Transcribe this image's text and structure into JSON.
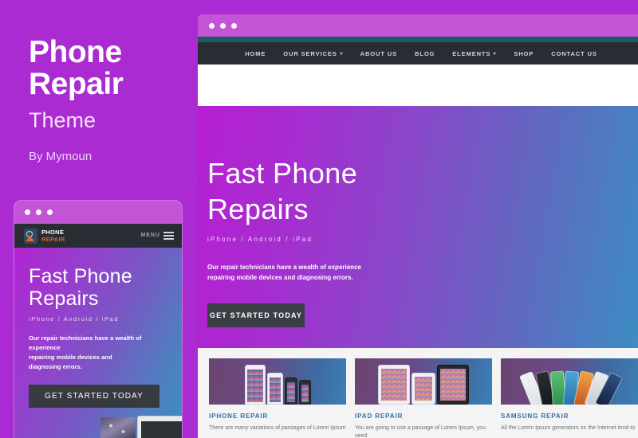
{
  "promo": {
    "title_line1": "Phone",
    "title_line2": "Repair",
    "subtitle": "Theme",
    "author": "By Mymoun"
  },
  "colors": {
    "page_background": "#a92bd1",
    "titlebar": "#c254d5",
    "nav_dark": "#272d33",
    "accent_teal": "#1d5b63",
    "hero_gradient_start": "#b61fd2",
    "hero_gradient_end": "#3b8ec4",
    "button_dark": "#3b3f45",
    "card_title": "#2f6fa8",
    "logo_accent": "#e8622a",
    "cards_background": "#f4f4f4"
  },
  "desktop": {
    "window_dots": [
      "dot",
      "dot",
      "dot"
    ],
    "nav": [
      {
        "label": "HOME",
        "has_caret": false
      },
      {
        "label": "OUR SERVICES",
        "has_caret": true
      },
      {
        "label": "ABOUT US",
        "has_caret": false
      },
      {
        "label": "BLOG",
        "has_caret": false
      },
      {
        "label": "ELEMENTS",
        "has_caret": true
      },
      {
        "label": "SHOP",
        "has_caret": false
      },
      {
        "label": "CONTACT US",
        "has_caret": false
      }
    ],
    "hero": {
      "heading_line1": "Fast Phone",
      "heading_line2": "Repairs",
      "tagline": "iPhone / Android / iPad",
      "description_line1": "Our repair technicians have a wealth of experience",
      "description_line2": "repairing mobile devices and diagnosing errors.",
      "cta": "GET STARTED TODAY"
    },
    "cards": [
      {
        "title": "IPHONE REPAIR",
        "text": "There are many variations of passages of Lorem Ipsum"
      },
      {
        "title": "IPAD REPAIR",
        "text": "You are going to use a passage of Lorem Ipsum, you need"
      },
      {
        "title": "SAMSUNG REPAIR",
        "text": "All the Lorem Ipsum generators on the Internet tend to"
      }
    ]
  },
  "mobile": {
    "window_dots": [
      "dot",
      "dot",
      "dot"
    ],
    "logo": {
      "line1": "PHONE",
      "line2": "REPAIR"
    },
    "menu_label": "MENU",
    "hero": {
      "heading_line1": "Fast Phone",
      "heading_line2": "Repairs",
      "tagline": "iPhone / Android / iPad",
      "description_line1": "Our repair technicians have a wealth of",
      "description_line2": "experience",
      "description_line3": "repairing mobile devices and",
      "description_line4": "diagnosing errors.",
      "cta": "GET STARTED TODAY"
    }
  }
}
